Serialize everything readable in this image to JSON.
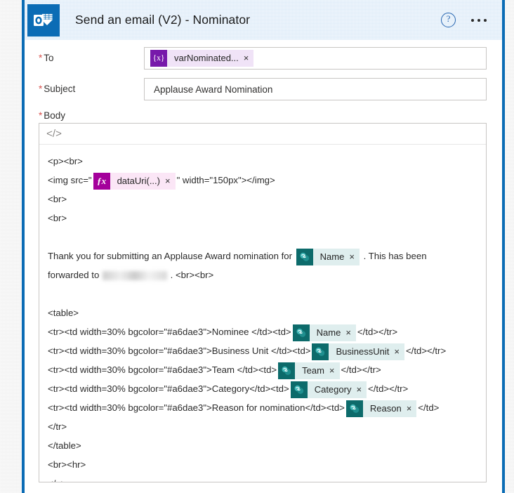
{
  "header": {
    "title": "Send an email (V2) - Nominator",
    "app_icon": "outlook-icon",
    "help_icon": "?",
    "more_menu": "more-options-icon"
  },
  "fields": {
    "to": {
      "label": "To",
      "required_marker": "*",
      "token": {
        "kind": "variable",
        "chip": "{x}",
        "label": "varNominated...",
        "remove": "×"
      }
    },
    "subject": {
      "label": "Subject",
      "required_marker": "*",
      "value": "Applause Award Nomination"
    },
    "body": {
      "label": "Body",
      "required_marker": "*",
      "toolbar": {
        "code_view": "</>"
      }
    }
  },
  "tokens": {
    "fx_chip": "ƒx",
    "sp_chip": "sharepoint-icon",
    "remove": "×",
    "data_uri": "dataUri(...)",
    "name": "Name",
    "business_unit": "BusinessUnit",
    "team": "Team",
    "category": "Category",
    "reason": "Reason"
  },
  "code": {
    "line_p_br": "<p><br>",
    "img_prefix": "<img src=\"",
    "img_suffix": "\" width=\"150px\"></img>",
    "br1": "<br>",
    "br2": "<br>",
    "thanks_before": "Thank you for submitting an Applause Award nomination for",
    "thanks_after": ". This has been",
    "forwarded_before": "forwarded to",
    "forwarded_after": ". <br><br>",
    "table_open": "<table>",
    "row_nominee_before": "<tr><td width=30% bgcolor=\"#a6dae3\">Nominee </td><td>",
    "row_nominee_after": "</td></tr>",
    "row_bu_before": "<tr><td width=30% bgcolor=\"#a6dae3\">Business Unit </td><td>",
    "row_bu_after": "</td></tr>",
    "row_team_before": "<tr><td width=30% bgcolor=\"#a6dae3\">Team </td><td>",
    "row_team_after": "</td></tr>",
    "row_category_before": "<tr><td width=30% bgcolor=\"#a6dae3\">Category</td><td>",
    "row_category_after": "</td></tr>",
    "row_reason_before": "<tr><td width=30% bgcolor=\"#a6dae3\">Reason for nomination</td><td>",
    "row_reason_after": "</td>",
    "tr_close": "</tr>",
    "table_close": "</table>",
    "br_hr": "<br><hr>",
    "p_close": "</p>"
  },
  "colors": {
    "accent_border": "#0b6cb5",
    "header_bg": "#dbeaf8",
    "variable_token": "#7719aa",
    "expression_token": "#a4009b",
    "sharepoint_token": "#0d6b6b",
    "required_marker": "#d9534f",
    "table_bgcolor_literal": "#a6dae3"
  }
}
